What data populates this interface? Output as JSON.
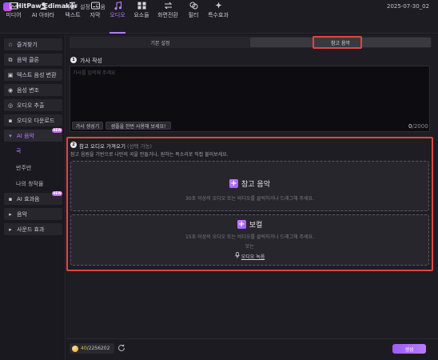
{
  "app": {
    "title": "HitPaw Edimakor",
    "date": "2025-07-30_02"
  },
  "menu": [
    "파일",
    "설정",
    "도움"
  ],
  "toolbar": [
    {
      "label": "미디어",
      "icon": "media-icon"
    },
    {
      "label": "AI 아바타",
      "icon": "avatar-icon"
    },
    {
      "label": "텍스트",
      "icon": "text-icon"
    },
    {
      "label": "자막",
      "icon": "subtitle-icon"
    },
    {
      "label": "오디오",
      "icon": "audio-icon"
    },
    {
      "label": "요소들",
      "icon": "elements-icon"
    },
    {
      "label": "화면전환",
      "icon": "transition-icon"
    },
    {
      "label": "필터",
      "icon": "filter-icon"
    },
    {
      "label": "특수효과",
      "icon": "effects-icon"
    }
  ],
  "sidebar": {
    "items": [
      {
        "label": "즐겨찾기",
        "icon": "star-icon"
      },
      {
        "label": "음악 클론",
        "icon": "clone-icon"
      },
      {
        "label": "텍스트 음성 변환",
        "icon": "tts-icon"
      },
      {
        "label": "음성 변조",
        "icon": "voice-changer-icon"
      },
      {
        "label": "오디오 추출",
        "icon": "extract-icon"
      },
      {
        "label": "오디오 다운로드",
        "icon": "download-icon"
      },
      {
        "label": "AI 음악",
        "icon": "ai-music-icon",
        "badge": "NEW"
      },
      {
        "label": "AI 효과음",
        "icon": "ai-sfx-icon",
        "badge": "NEW"
      },
      {
        "label": "음악",
        "icon": "caret-right-icon"
      },
      {
        "label": "사운드 효과",
        "icon": "caret-right-icon"
      }
    ],
    "sub_items": [
      "곡",
      "반주만",
      "나의 창작물"
    ]
  },
  "tabs": {
    "basic": "기본 설정",
    "reference": "참고 음악"
  },
  "lyrics": {
    "number": "1",
    "title": "가사 작성",
    "placeholder": "가사를 입력해 주세요",
    "generate_lyrics_button": "가사 생성기",
    "tips_button": "샘플을 한번 사용해 보세요!",
    "counter_value": "0",
    "counter_max": "/2000"
  },
  "reference": {
    "number": "2",
    "title": "참고 오디오 가져오기",
    "optional": "(선택 가능)",
    "description": "참고 음원을 기반으로 나만의 곡을 만들거나, 원하는 목소리로 직접 불러보세요.",
    "music": {
      "title": "참고 음악",
      "hint": "30초 이상의 오디오 또는 비디오를 클릭하거나 드래그해 주세요."
    },
    "vocal": {
      "title": "보컬",
      "hint": "15초 이상의 오디오 또는 비디오를 클릭하거나 드래그해 주세요.",
      "or": "또는",
      "record": "오디오 녹음"
    }
  },
  "footer": {
    "credits_used": "40",
    "credits_total": "/2256202",
    "generate_button": "생성"
  },
  "colors": {
    "accent": "#b47cff",
    "highlight": "#e0463f",
    "background": "#1e1d24"
  }
}
